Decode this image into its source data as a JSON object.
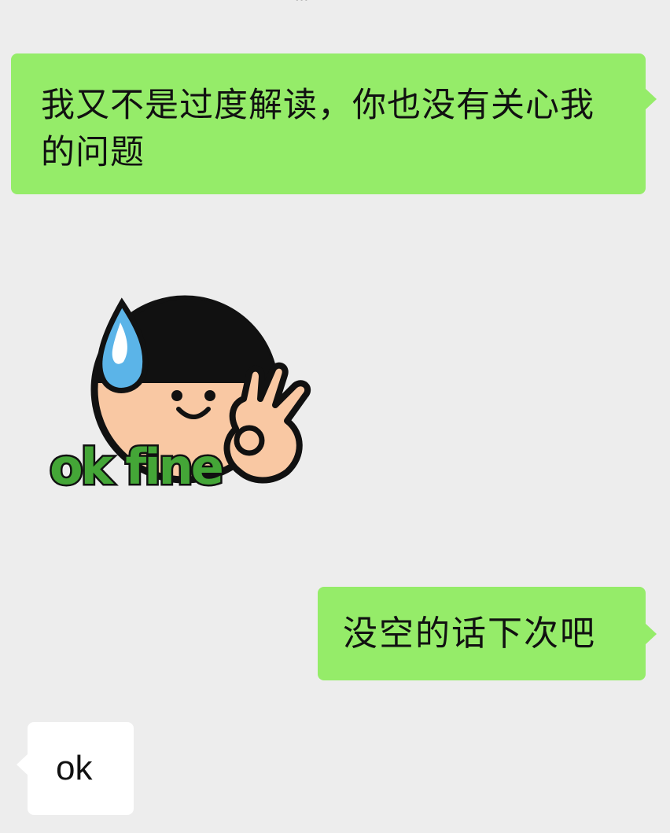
{
  "chat": {
    "top_partial_text": "···",
    "messages": [
      {
        "side": "sent",
        "type": "text",
        "text": "我又不是过度解读，你也没有关心我的问题"
      },
      {
        "side": "received",
        "type": "sticker",
        "sticker_text": "ok fine",
        "sticker_icon": "ok-fine-sticker"
      },
      {
        "side": "sent",
        "type": "text",
        "text": "没空的话下次吧"
      },
      {
        "side": "received",
        "type": "text",
        "text": "ok"
      }
    ]
  },
  "colors": {
    "background": "#ededed",
    "sent_bubble": "#95ec69",
    "received_bubble": "#ffffff",
    "sticker_text": "#44a637",
    "sticker_skin": "#f9c8a3",
    "sticker_drop": "#5bb4e8"
  }
}
